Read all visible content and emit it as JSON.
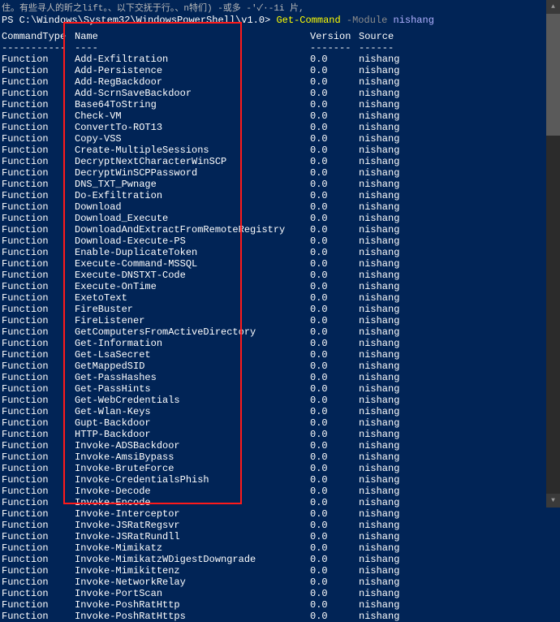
{
  "top_text": "住。有些寻人的昕之lift。、以下交抚于行。、n特们)  -或多 -'✓·-1i 片,",
  "prompt": {
    "path": "PS C:\\Windows\\System32\\WindowsPowerShell\\v1.0> ",
    "command": "Get-Command ",
    "param": "-Module ",
    "value": "nishang"
  },
  "headers": {
    "type": "CommandType",
    "name": "Name",
    "version": "Version",
    "source": "Source"
  },
  "dashes": {
    "type": "-----------",
    "name": "----",
    "version": "-------",
    "source": "------"
  },
  "rows": [
    {
      "type": "Function",
      "name": "Add-Exfiltration",
      "version": "0.0",
      "source": "nishang"
    },
    {
      "type": "Function",
      "name": "Add-Persistence",
      "version": "0.0",
      "source": "nishang"
    },
    {
      "type": "Function",
      "name": "Add-RegBackdoor",
      "version": "0.0",
      "source": "nishang"
    },
    {
      "type": "Function",
      "name": "Add-ScrnSaveBackdoor",
      "version": "0.0",
      "source": "nishang"
    },
    {
      "type": "Function",
      "name": "Base64ToString",
      "version": "0.0",
      "source": "nishang"
    },
    {
      "type": "Function",
      "name": "Check-VM",
      "version": "0.0",
      "source": "nishang"
    },
    {
      "type": "Function",
      "name": "ConvertTo-ROT13",
      "version": "0.0",
      "source": "nishang"
    },
    {
      "type": "Function",
      "name": "Copy-VSS",
      "version": "0.0",
      "source": "nishang"
    },
    {
      "type": "Function",
      "name": "Create-MultipleSessions",
      "version": "0.0",
      "source": "nishang"
    },
    {
      "type": "Function",
      "name": "DecryptNextCharacterWinSCP",
      "version": "0.0",
      "source": "nishang"
    },
    {
      "type": "Function",
      "name": "DecryptWinSCPPassword",
      "version": "0.0",
      "source": "nishang"
    },
    {
      "type": "Function",
      "name": "DNS_TXT_Pwnage",
      "version": "0.0",
      "source": "nishang"
    },
    {
      "type": "Function",
      "name": "Do-Exfiltration",
      "version": "0.0",
      "source": "nishang"
    },
    {
      "type": "Function",
      "name": "Download",
      "version": "0.0",
      "source": "nishang"
    },
    {
      "type": "Function",
      "name": "Download_Execute",
      "version": "0.0",
      "source": "nishang"
    },
    {
      "type": "Function",
      "name": "DownloadAndExtractFromRemoteRegistry",
      "version": "0.0",
      "source": "nishang"
    },
    {
      "type": "Function",
      "name": "Download-Execute-PS",
      "version": "0.0",
      "source": "nishang"
    },
    {
      "type": "Function",
      "name": "Enable-DuplicateToken",
      "version": "0.0",
      "source": "nishang"
    },
    {
      "type": "Function",
      "name": "Execute-Command-MSSQL",
      "version": "0.0",
      "source": "nishang"
    },
    {
      "type": "Function",
      "name": "Execute-DNSTXT-Code",
      "version": "0.0",
      "source": "nishang"
    },
    {
      "type": "Function",
      "name": "Execute-OnTime",
      "version": "0.0",
      "source": "nishang"
    },
    {
      "type": "Function",
      "name": "ExetoText",
      "version": "0.0",
      "source": "nishang"
    },
    {
      "type": "Function",
      "name": "FireBuster",
      "version": "0.0",
      "source": "nishang"
    },
    {
      "type": "Function",
      "name": "FireListener",
      "version": "0.0",
      "source": "nishang"
    },
    {
      "type": "Function",
      "name": "GetComputersFromActiveDirectory",
      "version": "0.0",
      "source": "nishang"
    },
    {
      "type": "Function",
      "name": "Get-Information",
      "version": "0.0",
      "source": "nishang"
    },
    {
      "type": "Function",
      "name": "Get-LsaSecret",
      "version": "0.0",
      "source": "nishang"
    },
    {
      "type": "Function",
      "name": "GetMappedSID",
      "version": "0.0",
      "source": "nishang"
    },
    {
      "type": "Function",
      "name": "Get-PassHashes",
      "version": "0.0",
      "source": "nishang"
    },
    {
      "type": "Function",
      "name": "Get-PassHints",
      "version": "0.0",
      "source": "nishang"
    },
    {
      "type": "Function",
      "name": "Get-WebCredentials",
      "version": "0.0",
      "source": "nishang"
    },
    {
      "type": "Function",
      "name": "Get-Wlan-Keys",
      "version": "0.0",
      "source": "nishang"
    },
    {
      "type": "Function",
      "name": "Gupt-Backdoor",
      "version": "0.0",
      "source": "nishang"
    },
    {
      "type": "Function",
      "name": "HTTP-Backdoor",
      "version": "0.0",
      "source": "nishang"
    },
    {
      "type": "Function",
      "name": "Invoke-ADSBackdoor",
      "version": "0.0",
      "source": "nishang"
    },
    {
      "type": "Function",
      "name": "Invoke-AmsiBypass",
      "version": "0.0",
      "source": "nishang"
    },
    {
      "type": "Function",
      "name": "Invoke-BruteForce",
      "version": "0.0",
      "source": "nishang"
    },
    {
      "type": "Function",
      "name": "Invoke-CredentialsPhish",
      "version": "0.0",
      "source": "nishang"
    },
    {
      "type": "Function",
      "name": "Invoke-Decode",
      "version": "0.0",
      "source": "nishang"
    },
    {
      "type": "Function",
      "name": "Invoke-Encode",
      "version": "0.0",
      "source": "nishang"
    },
    {
      "type": "Function",
      "name": "Invoke-Interceptor",
      "version": "0.0",
      "source": "nishang"
    },
    {
      "type": "Function",
      "name": "Invoke-JSRatRegsvr",
      "version": "0.0",
      "source": "nishang"
    },
    {
      "type": "Function",
      "name": "Invoke-JSRatRundll",
      "version": "0.0",
      "source": "nishang"
    },
    {
      "type": "Function",
      "name": "Invoke-Mimikatz",
      "version": "0.0",
      "source": "nishang"
    },
    {
      "type": "Function",
      "name": "Invoke-MimikatzWDigestDowngrade",
      "version": "0.0",
      "source": "nishang"
    },
    {
      "type": "Function",
      "name": "Invoke-Mimikittenz",
      "version": "0.0",
      "source": "nishang"
    },
    {
      "type": "Function",
      "name": "Invoke-NetworkRelay",
      "version": "0.0",
      "source": "nishang"
    },
    {
      "type": "Function",
      "name": "Invoke-PortScan",
      "version": "0.0",
      "source": "nishang"
    },
    {
      "type": "Function",
      "name": "Invoke-PoshRatHttp",
      "version": "0.0",
      "source": "nishang"
    },
    {
      "type": "Function",
      "name": "Invoke-PoshRatHttps",
      "version": "0.0",
      "source": "nishang"
    }
  ]
}
